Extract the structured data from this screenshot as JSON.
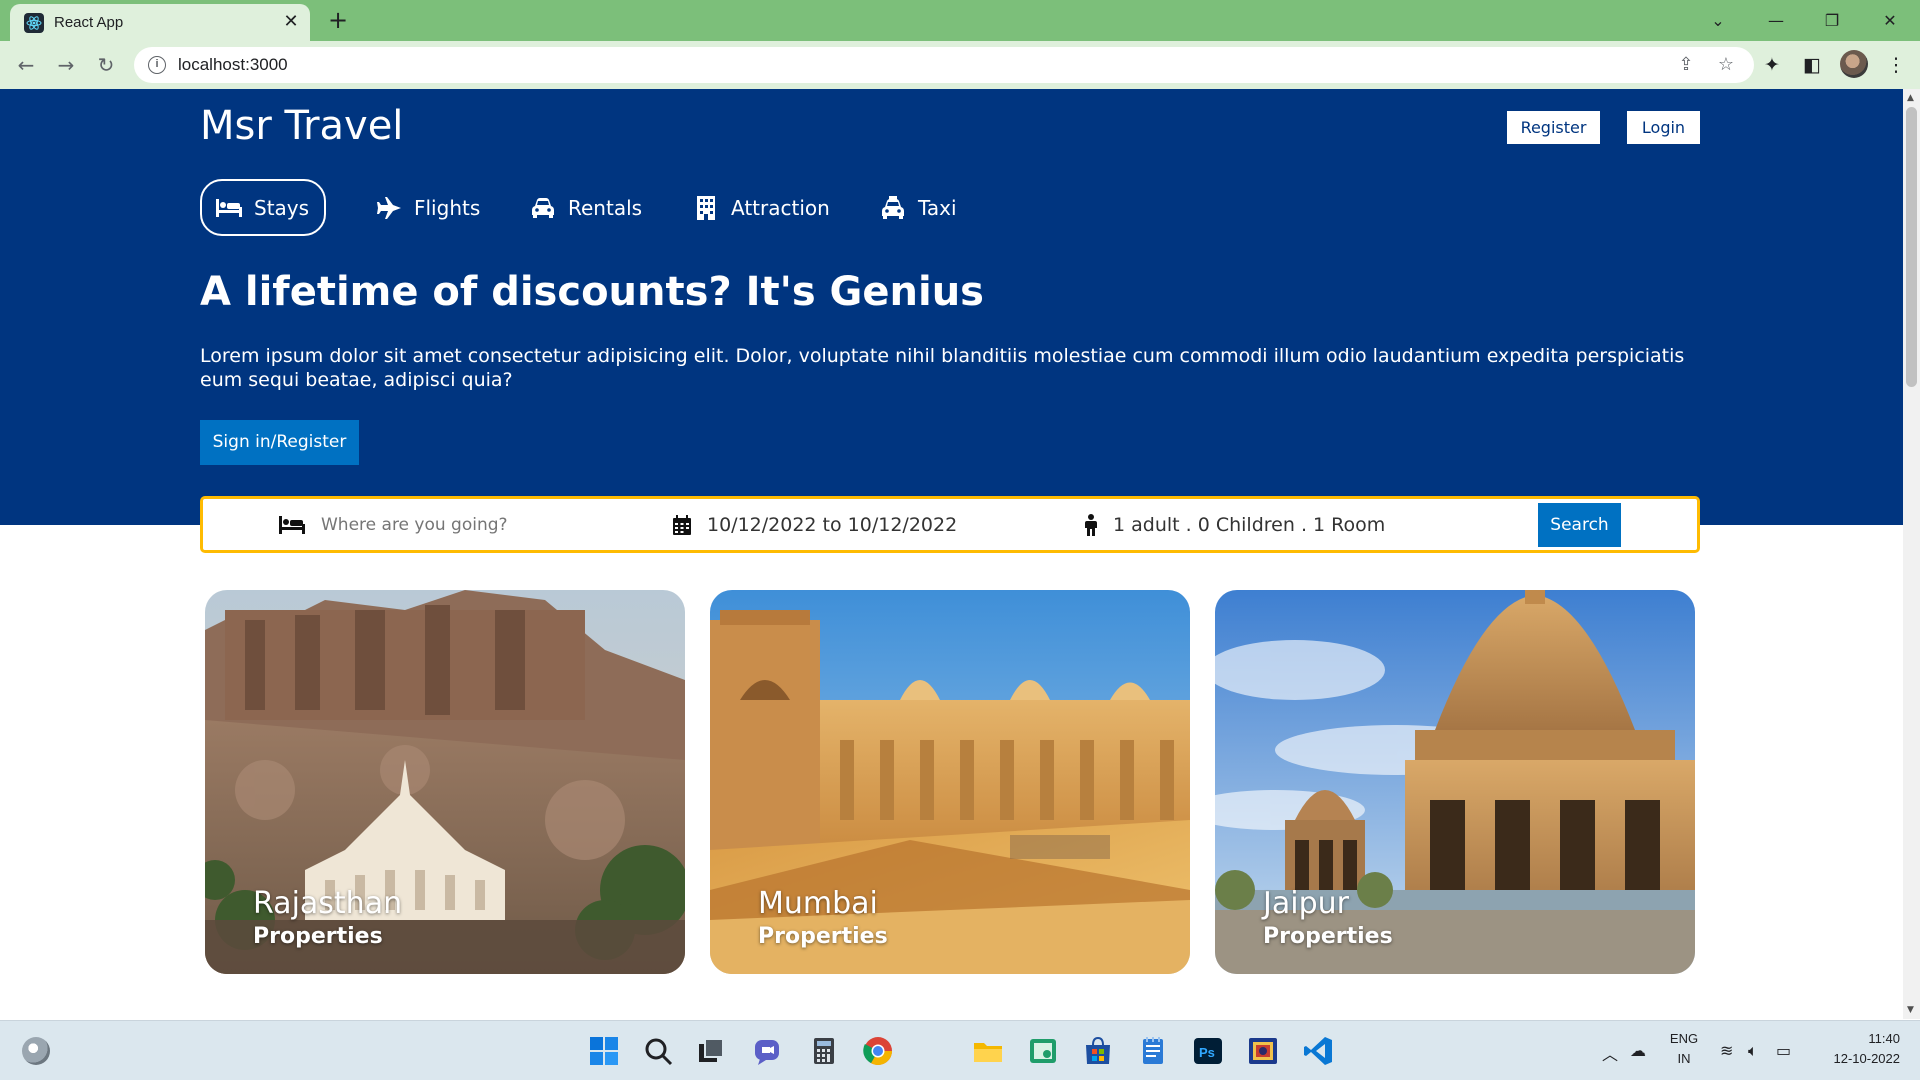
{
  "browser": {
    "tab_title": "React App",
    "tab_close": "✕",
    "new_tab": "+",
    "url": "localhost:3000",
    "info_icon": "i"
  },
  "site": {
    "brand": "Msr Travel",
    "register_label": "Register",
    "login_label": "Login",
    "nav": [
      {
        "label": "Stays",
        "icon": "bed-icon",
        "active": true
      },
      {
        "label": "Flights",
        "icon": "plane-icon",
        "active": false
      },
      {
        "label": "Rentals",
        "icon": "car-icon",
        "active": false
      },
      {
        "label": "Attraction",
        "icon": "building-icon",
        "active": false
      },
      {
        "label": "Taxi",
        "icon": "taxi-icon",
        "active": false
      }
    ],
    "hero": {
      "title": "A lifetime of discounts? It's Genius",
      "description": "Lorem ipsum dolor sit amet consectetur adipisicing elit. Dolor, voluptate nihil blanditiis molestiae cum commodi illum odio laudantium expedita perspiciatis eum sequi beatae, adipisci quia?",
      "cta_label": "Sign in/Register"
    },
    "search": {
      "destination_placeholder": "Where are you going?",
      "date_range": "10/12/2022 to 10/12/2022",
      "occupancy": "1 adult . 0 Children . 1 Room",
      "button_label": "Search"
    },
    "cards": [
      {
        "title": "Rajasthan",
        "subtitle": "Properties"
      },
      {
        "title": "Mumbai",
        "subtitle": "Properties"
      },
      {
        "title": "Jaipur",
        "subtitle": "Properties"
      }
    ]
  },
  "taskbar": {
    "language": "ENG",
    "region": "IN",
    "time": "11:40",
    "date": "12-10-2022"
  },
  "colors": {
    "header_bg": "#003580",
    "button_blue": "#0071c2",
    "search_border": "#febb02",
    "browser_frame": "#7cbf7a"
  }
}
